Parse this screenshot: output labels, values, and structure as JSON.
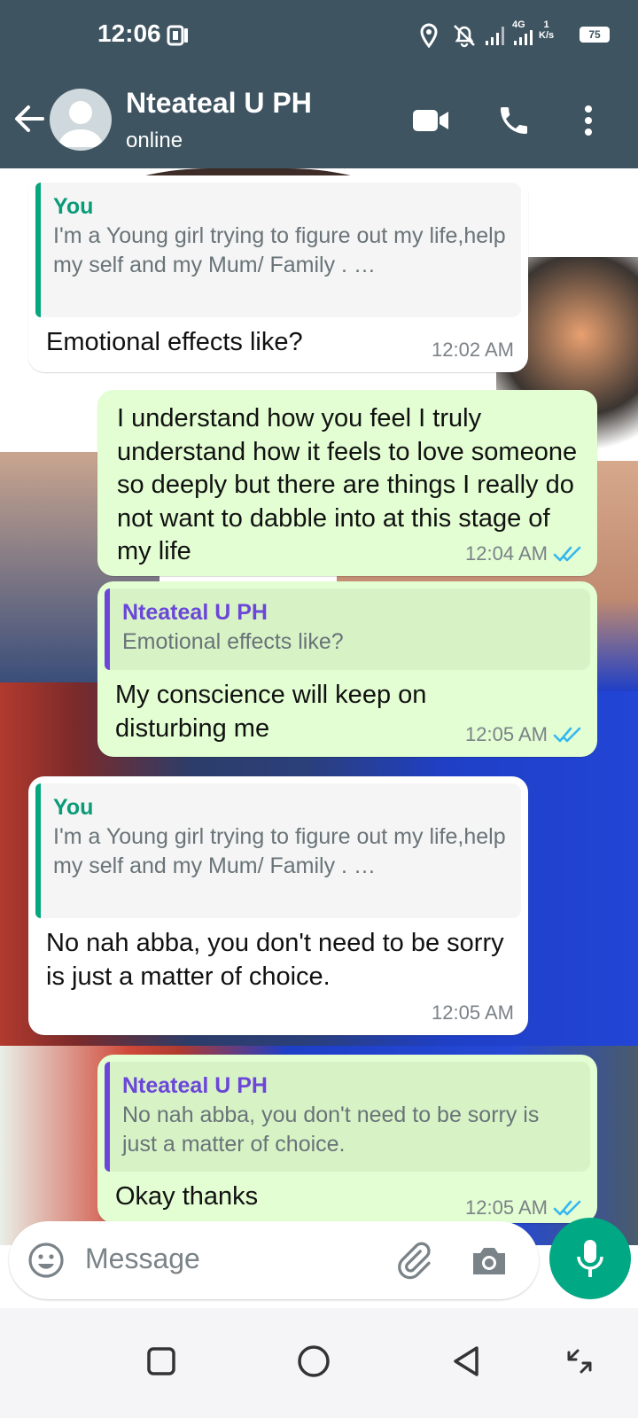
{
  "status_bar": {
    "time": "12:06",
    "network_type": "4G",
    "net_speed_value": "1",
    "net_speed_unit": "K/s",
    "battery": "75"
  },
  "header": {
    "contact_name": "Nteateal U PH",
    "contact_status": "online",
    "icons": [
      "back-arrow-icon",
      "avatar-placeholder-icon",
      "video-call-icon",
      "phone-icon",
      "more-vert-icon"
    ]
  },
  "messages": [
    {
      "direction": "incoming",
      "quote_author": "You",
      "quote_text": "I'm a Young girl trying to figure out my life,help my self and my Mum/ Family . …",
      "text": "Emotional effects like?",
      "time": "12:02 AM"
    },
    {
      "direction": "outgoing",
      "text": "I understand how you feel I truly understand how it feels to love someone so deeply but there are things I really do not want to dabble into at this stage of my life",
      "time": "12:04 AM",
      "read": true
    },
    {
      "direction": "outgoing",
      "quote_author": "Nteateal U PH",
      "quote_text": "Emotional effects like?",
      "text": "My conscience will keep on disturbing me",
      "time": "12:05 AM",
      "read": true
    },
    {
      "direction": "incoming",
      "quote_author": "You",
      "quote_text": "I'm a Young girl trying to figure out my life,help my self and my Mum/ Family . …",
      "text": "No nah abba, you don't need to be sorry is just a matter of choice.",
      "time": "12:05 AM"
    },
    {
      "direction": "outgoing",
      "quote_author": "Nteateal U PH",
      "quote_text": "No nah abba, you don't need to be sorry is just a matter of choice.",
      "text": "Okay thanks",
      "time": "12:05 AM",
      "read": true
    }
  ],
  "composer": {
    "placeholder": "Message",
    "icons": [
      "emoji-icon",
      "attach-icon",
      "camera-icon",
      "mic-icon"
    ]
  },
  "colors": {
    "header_bg": "#3f5461",
    "outgoing_bubble": "#e2fed2",
    "incoming_bubble": "#ffffff",
    "accent_green": "#01a884",
    "quote_you": "#0a9b78",
    "quote_contact": "#6b46d8",
    "read_ticks": "#34b7f1"
  }
}
